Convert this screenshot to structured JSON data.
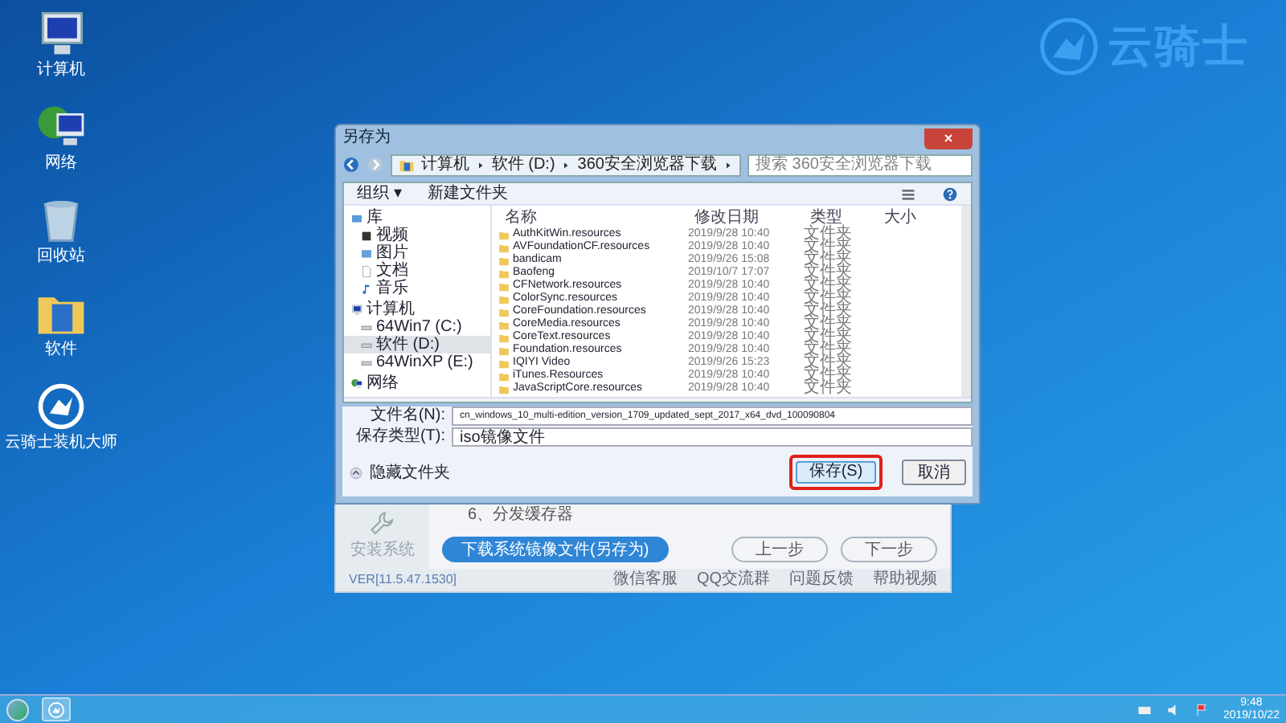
{
  "logo": {
    "text": "云骑士"
  },
  "desktop_icons": [
    {
      "kind": "computer",
      "label": "计算机"
    },
    {
      "kind": "network",
      "label": "网络"
    },
    {
      "kind": "recycle",
      "label": "回收站"
    },
    {
      "kind": "folder",
      "label": "软件"
    },
    {
      "kind": "app",
      "label": "云骑士装机大师"
    }
  ],
  "app_window": {
    "sidebar_item": "安装系统",
    "content_line": "6、分发缓存器",
    "download_button": "下载系统镜像文件(另存为)",
    "prev_button": "上一步",
    "next_button": "下一步",
    "version": "VER[11.5.47.1530]",
    "footer_links": [
      "微信客服",
      "QQ交流群",
      "问题反馈",
      "帮助视频"
    ]
  },
  "dialog": {
    "title": "另存为",
    "breadcrumbs": [
      "计算机",
      "软件 (D:)",
      "360安全浏览器下载"
    ],
    "search": {
      "placeholder": "搜索 360安全浏览器下载"
    },
    "toolbar": [
      "组织 ▾",
      "新建文件夹"
    ],
    "nav": [
      {
        "kind": "library",
        "label": "库",
        "selected": false,
        "children": [
          {
            "kind": "video",
            "label": "视频",
            "selected": false
          },
          {
            "kind": "picture",
            "label": "图片",
            "selected": false
          },
          {
            "kind": "document",
            "label": "文档",
            "selected": false
          },
          {
            "kind": "music",
            "label": "音乐",
            "selected": false
          }
        ]
      },
      {
        "kind": "computer",
        "label": "计算机",
        "selected": false,
        "children": [
          {
            "kind": "drive",
            "label": "64Win7  (C:)",
            "selected": false
          },
          {
            "kind": "drive",
            "label": "软件 (D:)",
            "selected": true
          },
          {
            "kind": "drive",
            "label": "64WinXP  (E:)",
            "selected": false
          }
        ]
      },
      {
        "kind": "network",
        "label": "网络",
        "selected": false
      }
    ],
    "columns": [
      "名称",
      "修改日期",
      "类型",
      "大小"
    ],
    "rows": [
      [
        "AuthKitWin.resources",
        "2019/9/28 10:40",
        "文件夹"
      ],
      [
        "AVFoundationCF.resources",
        "2019/9/28 10:40",
        "文件夹"
      ],
      [
        "bandicam",
        "2019/9/26 15:08",
        "文件夹"
      ],
      [
        "Baofeng",
        "2019/10/7 17:07",
        "文件夹"
      ],
      [
        "CFNetwork.resources",
        "2019/9/28 10:40",
        "文件夹"
      ],
      [
        "ColorSync.resources",
        "2019/9/28 10:40",
        "文件夹"
      ],
      [
        "CoreFoundation.resources",
        "2019/9/28 10:40",
        "文件夹"
      ],
      [
        "CoreMedia.resources",
        "2019/9/28 10:40",
        "文件夹"
      ],
      [
        "CoreText.resources",
        "2019/9/28 10:40",
        "文件夹"
      ],
      [
        "Foundation.resources",
        "2019/9/28 10:40",
        "文件夹"
      ],
      [
        "IQIYI Video",
        "2019/9/26 15:23",
        "文件夹"
      ],
      [
        "iTunes.Resources",
        "2019/9/28 10:40",
        "文件夹"
      ],
      [
        "JavaScriptCore.resources",
        "2019/9/28 10:40",
        "文件夹"
      ]
    ],
    "filename_label": "文件名(N):",
    "filename": "cn_windows_10_multi-edition_version_1709_updated_sept_2017_x64_dvd_100090804",
    "filetype_label": "保存类型(T):",
    "filetype": "iso镜像文件",
    "hide_folders": "隐藏文件夹",
    "save_button": {
      "label": "保存(S)",
      "highlighted": true
    },
    "cancel_button": "取消"
  },
  "taskbar": {
    "time": "9:48",
    "date": "2019/10/22"
  }
}
